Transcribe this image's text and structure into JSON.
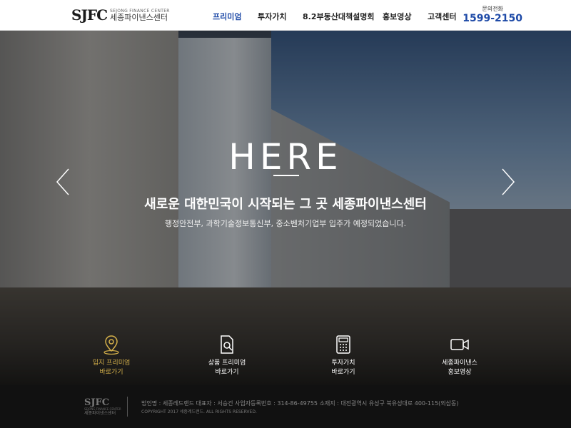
{
  "header": {
    "logo_mark": "SJFC",
    "logo_en": "SEJONG FINANCE CENTER",
    "logo_ko": "세종파이낸스센터",
    "nav": [
      {
        "label": "프리미엄"
      },
      {
        "label": "투자가치"
      },
      {
        "label": "8.2부동산대책설명회"
      },
      {
        "label": "홍보영상"
      },
      {
        "label": "고객센터"
      }
    ],
    "contact_label": "문의전화",
    "contact_number": "1599-2150"
  },
  "hero": {
    "title": "HERE",
    "subtitle": "새로운 대한민국이 시작되는 그 곳 세종파이낸스센터",
    "description": "행정안전부, 과학기술정보통신부, 중소벤처기업부 입주가 예정되었습니다."
  },
  "quick_links": [
    {
      "icon": "map-pin-icon",
      "line1": "입지 프리미엄",
      "line2": "바로가기",
      "color": "#d4b04a"
    },
    {
      "icon": "document-search-icon",
      "line1": "상품 프리미엄",
      "line2": "바로가기",
      "color": "#ffffff"
    },
    {
      "icon": "calculator-icon",
      "line1": "투자가치",
      "line2": "바로가기",
      "color": "#ffffff"
    },
    {
      "icon": "video-camera-icon",
      "line1": "세종파이낸스",
      "line2": "홍보영상",
      "color": "#ffffff"
    }
  ],
  "footer": {
    "logo_mark": "SJFC",
    "logo_en": "SEJONG FINANCE CENTER",
    "logo_ko": "세종파이낸스센터",
    "info": "법인명 : 세종레드랜드    대표자 : 서승건    사업자등록번호 : 314-86-49755    소재지 : 대전광역시 유성구 북유성대로 400-115(외삼동)",
    "copyright": "COPYRIGHT 2017 세종레드랜드. ALL RIGHTS RESERVED."
  },
  "colors": {
    "accent": "#1e4aa7",
    "gold": "#d4b04a"
  }
}
